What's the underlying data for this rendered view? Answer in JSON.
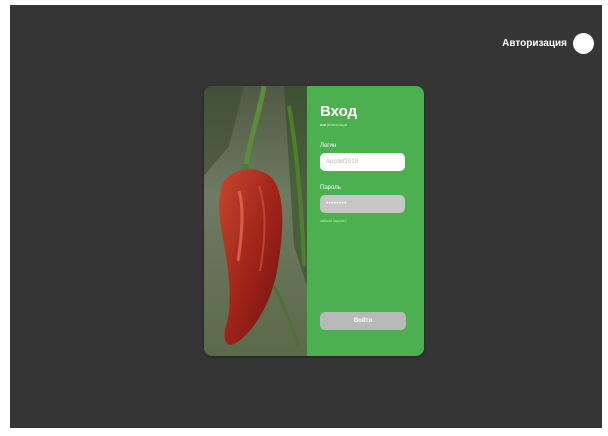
{
  "header": {
    "auth_label": "Авторизация"
  },
  "form": {
    "title": "Вход",
    "subline_prefix": "или",
    "subline_link": "регистрация",
    "login_label": "Логин",
    "login_value": "Apcdef2019",
    "password_label": "Пароль",
    "password_value": "••••••••",
    "forgot_link": "забыли пароль?",
    "submit_label": "Войти"
  },
  "colors": {
    "background": "#353535",
    "card_accent": "#4caf50",
    "button": "#b9b9b9"
  },
  "icons": [
    "avatar-circle",
    "chili-pepper-photo"
  ]
}
